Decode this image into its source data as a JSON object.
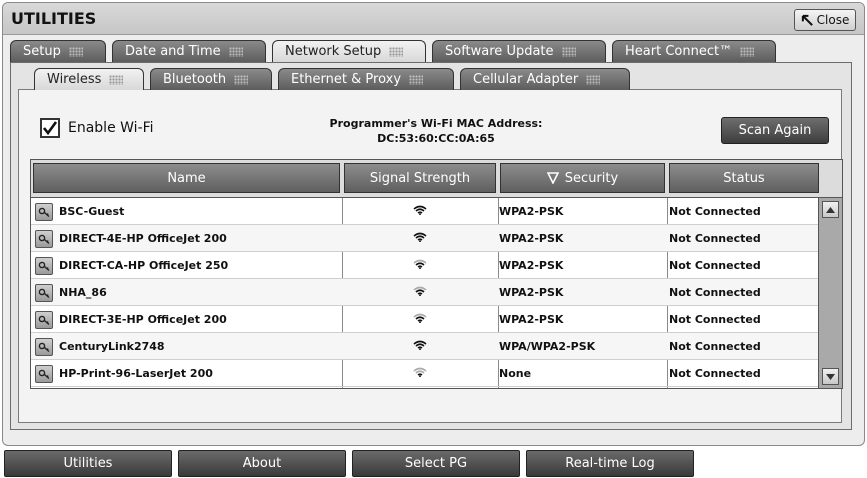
{
  "window": {
    "title": "UTILITIES",
    "close_label": "Close"
  },
  "top_tabs": [
    {
      "label": "Setup",
      "active": false
    },
    {
      "label": "Date and Time",
      "active": false
    },
    {
      "label": "Network Setup",
      "active": true
    },
    {
      "label": "Software Update",
      "active": false
    },
    {
      "label": "Heart Connect™",
      "active": false
    }
  ],
  "sub_tabs": [
    {
      "label": "Wireless",
      "active": true
    },
    {
      "label": "Bluetooth",
      "active": false
    },
    {
      "label": "Ethernet & Proxy",
      "active": false
    },
    {
      "label": "Cellular Adapter",
      "active": false
    }
  ],
  "wifi": {
    "enable_label": "Enable Wi-Fi",
    "enabled": true,
    "mac_label": "Programmer's Wi-Fi MAC Address:",
    "mac_value": "DC:53:60:CC:0A:65",
    "scan_label": "Scan Again"
  },
  "table": {
    "headers": {
      "name": "Name",
      "signal": "Signal Strength",
      "security": "Security",
      "status": "Status"
    },
    "sorted_by": "Security",
    "rows": [
      {
        "name": "BSC-Guest",
        "signal_icon": "wifi-signal-strong-icon",
        "security": "WPA2-PSK",
        "status": "Not Connected"
      },
      {
        "name": "DIRECT-4E-HP OfficeJet 200",
        "signal_icon": "wifi-signal-strong-icon",
        "security": "WPA2-PSK",
        "status": "Not Connected"
      },
      {
        "name": "DIRECT-CA-HP OfficeJet 250",
        "signal_icon": "wifi-signal-medium-icon",
        "security": "WPA2-PSK",
        "status": "Not Connected"
      },
      {
        "name": "NHA_86",
        "signal_icon": "wifi-signal-medium-icon",
        "security": "WPA2-PSK",
        "status": "Not Connected"
      },
      {
        "name": "DIRECT-3E-HP OfficeJet 200",
        "signal_icon": "wifi-signal-medium-icon",
        "security": "WPA2-PSK",
        "status": "Not Connected"
      },
      {
        "name": "CenturyLink2748",
        "signal_icon": "wifi-signal-strong-icon",
        "security": "WPA/WPA2-PSK",
        "status": "Not Connected"
      },
      {
        "name": "HP-Print-96-LaserJet 200",
        "signal_icon": "wifi-signal-weak-icon",
        "security": "None",
        "status": "Not Connected"
      }
    ]
  },
  "bottom_nav": [
    {
      "label": "Utilities",
      "active": false
    },
    {
      "label": "About",
      "active": false
    },
    {
      "label": "Select PG",
      "active": false
    },
    {
      "label": "Real-time Log",
      "active": false
    }
  ],
  "colors": {
    "tab_dark": "#6b6b6b",
    "tab_active": "#e6e6e6",
    "button_dark": "#4a4a4a"
  }
}
